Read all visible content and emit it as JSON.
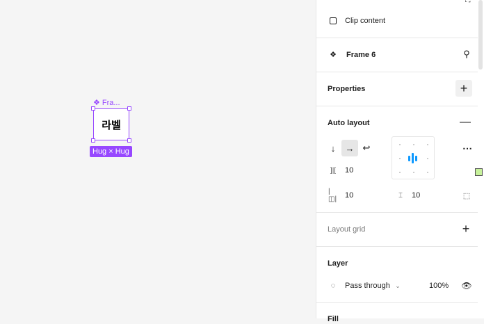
{
  "canvas": {
    "frame_label": "Fra...",
    "frame_text": "라벨",
    "hug_badge": "Hug × Hug"
  },
  "panel": {
    "clip_content_label": "Clip content",
    "frame_name": "Frame 6",
    "properties_title": "Properties",
    "auto_layout": {
      "title": "Auto layout",
      "gap_value": "10",
      "horizontal_padding": "10",
      "vertical_padding": "10",
      "direction": "horizontal"
    },
    "layout_grid_title": "Layout grid",
    "layer": {
      "title": "Layer",
      "blend_mode": "Pass through",
      "opacity": "100%"
    },
    "fill_title": "Fill"
  },
  "colors": {
    "selection": "#9747ff",
    "accent_blue": "#0d99ff",
    "swatch_green": "#c7f29b"
  }
}
